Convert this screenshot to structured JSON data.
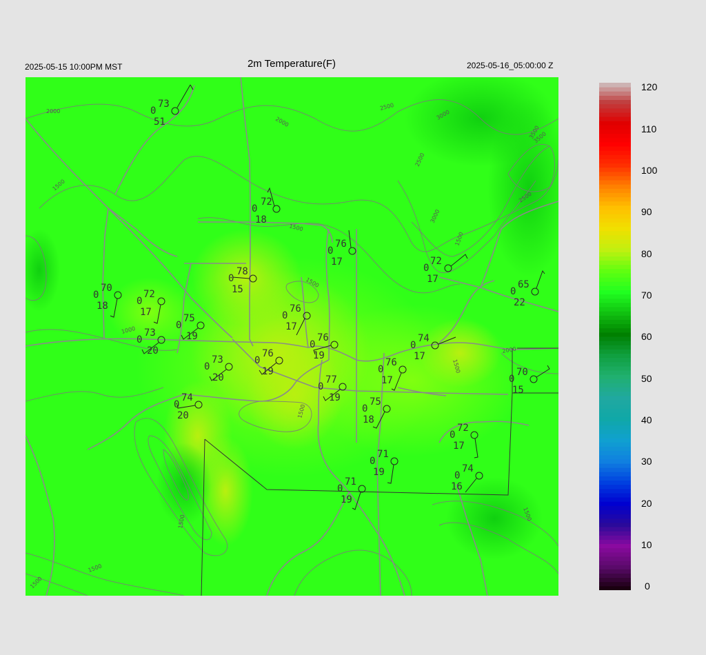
{
  "header": {
    "title": "2m Temperature(F)",
    "local_time": "2025-05-15 10:00PM MST",
    "utc_time": "2025-05-16_05:00:00 Z"
  },
  "colorbar": {
    "ticks": [
      "120",
      "110",
      "100",
      "90",
      "80",
      "70",
      "60",
      "50",
      "40",
      "30",
      "20",
      "10",
      "0"
    ],
    "stops": [
      {
        "v": 0,
        "c": "#1a0010"
      },
      {
        "v": 5,
        "c": "#5a0a6a"
      },
      {
        "v": 10,
        "c": "#8a0aa0"
      },
      {
        "v": 15,
        "c": "#2a0a9a"
      },
      {
        "v": 20,
        "c": "#0000d0"
      },
      {
        "v": 25,
        "c": "#0040e0"
      },
      {
        "v": 30,
        "c": "#1080e0"
      },
      {
        "v": 35,
        "c": "#10a0d0"
      },
      {
        "v": 40,
        "c": "#10a8a8"
      },
      {
        "v": 45,
        "c": "#20a8a0"
      },
      {
        "v": 50,
        "c": "#20b070"
      },
      {
        "v": 55,
        "c": "#10a040"
      },
      {
        "v": 60,
        "c": "#008000"
      },
      {
        "v": 65,
        "c": "#10c010"
      },
      {
        "v": 70,
        "c": "#20ff20"
      },
      {
        "v": 75,
        "c": "#60ff10"
      },
      {
        "v": 80,
        "c": "#c0f010"
      },
      {
        "v": 85,
        "c": "#f0e000"
      },
      {
        "v": 90,
        "c": "#ffc000"
      },
      {
        "v": 95,
        "c": "#ff8000"
      },
      {
        "v": 100,
        "c": "#ff3000"
      },
      {
        "v": 105,
        "c": "#ff0000"
      },
      {
        "v": 110,
        "c": "#e00000"
      },
      {
        "v": 115,
        "c": "#c04040"
      },
      {
        "v": 120,
        "c": "#d0d0d0"
      }
    ]
  },
  "contour_labels": [
    "2000",
    "2000",
    "2500",
    "3000",
    "3500",
    "2500",
    "1500",
    "1500",
    "1500",
    "1000",
    "2500",
    "3000",
    "3500",
    "1500",
    "2000",
    "1500",
    "1500",
    "1500",
    "1500",
    "1500",
    "1500"
  ],
  "stations": [
    {
      "t": "73",
      "mid": "0",
      "b": "51"
    },
    {
      "t": "72",
      "mid": "0",
      "b": "18"
    },
    {
      "t": "76",
      "mid": "0",
      "b": "17"
    },
    {
      "t": "72",
      "mid": "0",
      "b": "17"
    },
    {
      "t": "65",
      "mid": "0",
      "b": "22"
    },
    {
      "t": "78",
      "mid": "0",
      "b": "15"
    },
    {
      "t": "70",
      "mid": "0",
      "b": "18"
    },
    {
      "t": "72",
      "mid": "0",
      "b": "17"
    },
    {
      "t": "76",
      "mid": "0",
      "b": "17"
    },
    {
      "t": "75",
      "mid": "0",
      "b": "19"
    },
    {
      "t": "73",
      "mid": "0",
      "b": "20"
    },
    {
      "t": "76",
      "mid": "0",
      "b": "19"
    },
    {
      "t": "74",
      "mid": "0",
      "b": "17"
    },
    {
      "t": "76",
      "mid": "0",
      "b": "19"
    },
    {
      "t": "73",
      "mid": "0",
      "b": "20"
    },
    {
      "t": "76",
      "mid": "0",
      "b": "17"
    },
    {
      "t": "70",
      "mid": "0",
      "b": "15"
    },
    {
      "t": "77",
      "mid": "0",
      "b": "19"
    },
    {
      "t": "74",
      "mid": "0",
      "b": "20"
    },
    {
      "t": "75",
      "mid": "0",
      "b": "18"
    },
    {
      "t": "72",
      "mid": "0",
      "b": "17"
    },
    {
      "t": "71",
      "mid": "0",
      "b": "19"
    },
    {
      "t": "74",
      "mid": "0",
      "b": "16"
    },
    {
      "t": "71",
      "mid": "0",
      "b": "19"
    }
  ]
}
